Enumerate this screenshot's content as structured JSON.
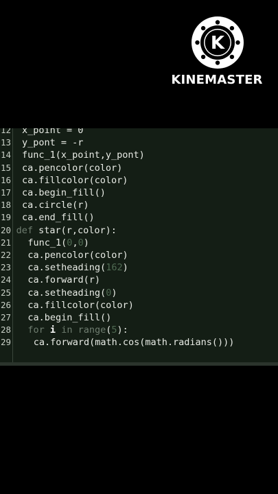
{
  "watermark": {
    "logo_letter": "K",
    "brand": "KINEMASTER"
  },
  "editor": {
    "lines": [
      {
        "no": "12",
        "indent": 1,
        "parts": [
          {
            "t": "x_point = 0",
            "c": ""
          }
        ]
      },
      {
        "no": "13",
        "indent": 1,
        "parts": [
          {
            "t": "y_pont = -r",
            "c": ""
          }
        ]
      },
      {
        "no": "14",
        "indent": 1,
        "parts": [
          {
            "t": "func_1(x_point,y_pont)",
            "c": ""
          }
        ]
      },
      {
        "no": "15",
        "indent": 1,
        "parts": [
          {
            "t": "ca.pencolor(color)",
            "c": ""
          }
        ]
      },
      {
        "no": "16",
        "indent": 1,
        "parts": [
          {
            "t": "ca.fillcolor(color)",
            "c": ""
          }
        ]
      },
      {
        "no": "17",
        "indent": 1,
        "parts": [
          {
            "t": "ca.begin_fill()",
            "c": ""
          }
        ]
      },
      {
        "no": "18",
        "indent": 1,
        "parts": [
          {
            "t": "ca.circle(r)",
            "c": ""
          }
        ]
      },
      {
        "no": "19",
        "indent": 1,
        "parts": [
          {
            "t": "ca.end_fill()",
            "c": ""
          }
        ]
      },
      {
        "no": "20",
        "indent": 0,
        "parts": [
          {
            "t": "def",
            "c": "kw"
          },
          {
            "t": " star(r,color):",
            "c": ""
          }
        ]
      },
      {
        "no": "21",
        "indent": 2,
        "parts": [
          {
            "t": "func_1(",
            "c": ""
          },
          {
            "t": "0",
            "c": "num"
          },
          {
            "t": ",",
            "c": ""
          },
          {
            "t": "0",
            "c": "num"
          },
          {
            "t": ")",
            "c": ""
          }
        ]
      },
      {
        "no": "22",
        "indent": 2,
        "parts": [
          {
            "t": "ca.pencolor(color)",
            "c": ""
          }
        ]
      },
      {
        "no": "23",
        "indent": 2,
        "parts": [
          {
            "t": "ca.setheading(",
            "c": ""
          },
          {
            "t": "162",
            "c": "num"
          },
          {
            "t": ")",
            "c": ""
          }
        ]
      },
      {
        "no": "24",
        "indent": 2,
        "parts": [
          {
            "t": "ca.forward(r)",
            "c": ""
          }
        ]
      },
      {
        "no": "25",
        "indent": 2,
        "parts": [
          {
            "t": "ca.setheading(",
            "c": ""
          },
          {
            "t": "0",
            "c": "num"
          },
          {
            "t": ")",
            "c": ""
          }
        ]
      },
      {
        "no": "26",
        "indent": 2,
        "parts": [
          {
            "t": "ca.fillcolor(color)",
            "c": ""
          }
        ]
      },
      {
        "no": "27",
        "indent": 2,
        "parts": [
          {
            "t": "ca.begin_fill()",
            "c": ""
          }
        ]
      },
      {
        "no": "28",
        "indent": 2,
        "parts": [
          {
            "t": "for",
            "c": "kw"
          },
          {
            "t": " ",
            "c": ""
          },
          {
            "t": "i",
            "c": "bold"
          },
          {
            "t": " ",
            "c": ""
          },
          {
            "t": "in",
            "c": "kw"
          },
          {
            "t": " ",
            "c": ""
          },
          {
            "t": "range",
            "c": "kw"
          },
          {
            "t": "(",
            "c": ""
          },
          {
            "t": "5",
            "c": "num"
          },
          {
            "t": "):",
            "c": ""
          }
        ]
      },
      {
        "no": "29",
        "indent": 3,
        "parts": [
          {
            "t": "ca.forward(math.cos(math.radians()))",
            "c": ""
          }
        ]
      }
    ]
  }
}
